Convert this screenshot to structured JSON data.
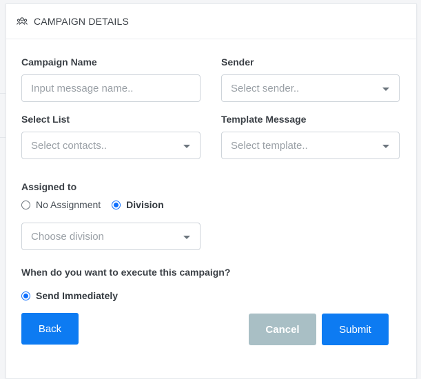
{
  "header": {
    "title": "CAMPAIGN DETAILS",
    "icon": "users-icon"
  },
  "form": {
    "campaign_name": {
      "label": "Campaign Name",
      "placeholder": "Input message name.."
    },
    "sender": {
      "label": "Sender",
      "placeholder": "Select sender.."
    },
    "select_list": {
      "label": "Select List",
      "placeholder": "Select contacts.."
    },
    "template_message": {
      "label": "Template Message",
      "placeholder": "Select template.."
    },
    "assigned_to": {
      "label": "Assigned to",
      "options": [
        "No Assignment",
        "Division"
      ],
      "selected": "Division",
      "division_placeholder": "Choose division"
    },
    "execute": {
      "question": "When do you want to execute this campaign?",
      "option": "Send Immediately",
      "selected": "Send Immediately"
    }
  },
  "buttons": {
    "back": "Back",
    "cancel": "Cancel",
    "submit": "Submit"
  },
  "colors": {
    "primary": "#0d7bf2",
    "cancel": "#a9bfc5",
    "radio_checked": "#0d6efd"
  }
}
